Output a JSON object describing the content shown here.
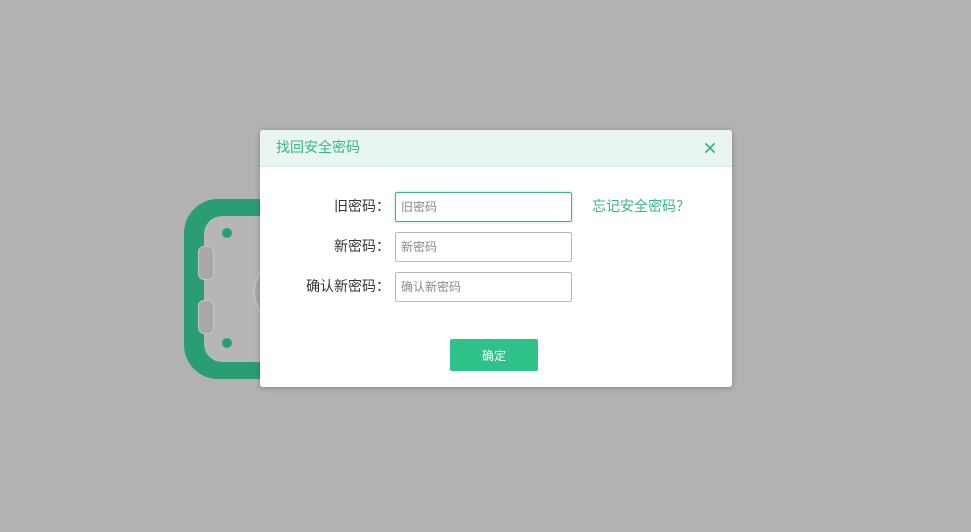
{
  "colors": {
    "overlay": "#b2b2b2",
    "accent": "#34b88a",
    "header_bg": "#e9f5f0",
    "button_bg": "#2ec288",
    "safe": "#2a9e72"
  },
  "background": {
    "illustration_icon": "safe-icon"
  },
  "dialog": {
    "title": "找回安全密码",
    "close_icon": "close-icon",
    "fields": {
      "old_password": {
        "label": "旧密码：",
        "placeholder": "旧密码",
        "value": ""
      },
      "new_password": {
        "label": "新密码：",
        "placeholder": "新密码",
        "value": ""
      },
      "confirm_password": {
        "label": "确认新密码：",
        "placeholder": "确认新密码",
        "value": ""
      }
    },
    "forgot_link": "忘记安全密码？",
    "submit_label": "确定"
  }
}
